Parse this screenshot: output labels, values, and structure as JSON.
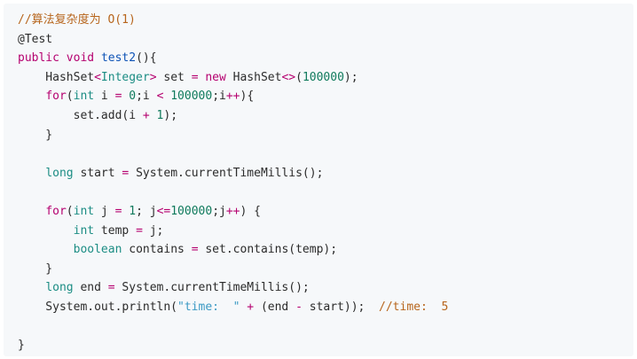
{
  "colors": {
    "background": "#f6f8fa",
    "comment": "#b7651c",
    "keyword": "#b5006f",
    "function": "#0e53b6",
    "type": "#1c8d84",
    "number": "#0f7a5c",
    "string": "#3c9ac4",
    "plain": "#2b2b2b"
  },
  "code": {
    "lines": [
      [
        {
          "t": "//算法复杂度为 O(1)",
          "k": "comment"
        }
      ],
      [
        {
          "t": "@Test",
          "k": "plain"
        }
      ],
      [
        {
          "t": "public",
          "k": "keyword"
        },
        {
          "t": " ",
          "k": "plain"
        },
        {
          "t": "void",
          "k": "keyword"
        },
        {
          "t": " ",
          "k": "plain"
        },
        {
          "t": "test2",
          "k": "function"
        },
        {
          "t": "(){",
          "k": "plain"
        }
      ],
      [
        {
          "t": "    HashSet",
          "k": "plain"
        },
        {
          "t": "<",
          "k": "operator"
        },
        {
          "t": "Integer",
          "k": "type"
        },
        {
          "t": ">",
          "k": "operator"
        },
        {
          "t": " set ",
          "k": "plain"
        },
        {
          "t": "=",
          "k": "operator"
        },
        {
          "t": " ",
          "k": "plain"
        },
        {
          "t": "new",
          "k": "keyword"
        },
        {
          "t": " HashSet",
          "k": "plain"
        },
        {
          "t": "<>",
          "k": "operator"
        },
        {
          "t": "(",
          "k": "plain"
        },
        {
          "t": "100000",
          "k": "number"
        },
        {
          "t": ");",
          "k": "plain"
        }
      ],
      [
        {
          "t": "    ",
          "k": "plain"
        },
        {
          "t": "for",
          "k": "keyword"
        },
        {
          "t": "(",
          "k": "plain"
        },
        {
          "t": "int",
          "k": "type"
        },
        {
          "t": " i ",
          "k": "plain"
        },
        {
          "t": "=",
          "k": "operator"
        },
        {
          "t": " ",
          "k": "plain"
        },
        {
          "t": "0",
          "k": "number"
        },
        {
          "t": ";i ",
          "k": "plain"
        },
        {
          "t": "<",
          "k": "operator"
        },
        {
          "t": " ",
          "k": "plain"
        },
        {
          "t": "100000",
          "k": "number"
        },
        {
          "t": ";i",
          "k": "plain"
        },
        {
          "t": "++",
          "k": "operator"
        },
        {
          "t": "){",
          "k": "plain"
        }
      ],
      [
        {
          "t": "        set.add(i ",
          "k": "plain"
        },
        {
          "t": "+",
          "k": "operator"
        },
        {
          "t": " ",
          "k": "plain"
        },
        {
          "t": "1",
          "k": "number"
        },
        {
          "t": ");",
          "k": "plain"
        }
      ],
      [
        {
          "t": "    }",
          "k": "plain"
        }
      ],
      [],
      [
        {
          "t": "    ",
          "k": "plain"
        },
        {
          "t": "long",
          "k": "type"
        },
        {
          "t": " start ",
          "k": "plain"
        },
        {
          "t": "=",
          "k": "operator"
        },
        {
          "t": " System.currentTimeMillis();",
          "k": "plain"
        }
      ],
      [],
      [
        {
          "t": "    ",
          "k": "plain"
        },
        {
          "t": "for",
          "k": "keyword"
        },
        {
          "t": "(",
          "k": "plain"
        },
        {
          "t": "int",
          "k": "type"
        },
        {
          "t": " j ",
          "k": "plain"
        },
        {
          "t": "=",
          "k": "operator"
        },
        {
          "t": " ",
          "k": "plain"
        },
        {
          "t": "1",
          "k": "number"
        },
        {
          "t": "; j",
          "k": "plain"
        },
        {
          "t": "<=",
          "k": "operator"
        },
        {
          "t": "100000",
          "k": "number"
        },
        {
          "t": ";j",
          "k": "plain"
        },
        {
          "t": "++",
          "k": "operator"
        },
        {
          "t": ") {",
          "k": "plain"
        }
      ],
      [
        {
          "t": "        ",
          "k": "plain"
        },
        {
          "t": "int",
          "k": "type"
        },
        {
          "t": " temp ",
          "k": "plain"
        },
        {
          "t": "=",
          "k": "operator"
        },
        {
          "t": " j;",
          "k": "plain"
        }
      ],
      [
        {
          "t": "        ",
          "k": "plain"
        },
        {
          "t": "boolean",
          "k": "type"
        },
        {
          "t": " contains ",
          "k": "plain"
        },
        {
          "t": "=",
          "k": "operator"
        },
        {
          "t": " set.contains(temp);",
          "k": "plain"
        }
      ],
      [
        {
          "t": "    }",
          "k": "plain"
        }
      ],
      [
        {
          "t": "    ",
          "k": "plain"
        },
        {
          "t": "long",
          "k": "type"
        },
        {
          "t": " end ",
          "k": "plain"
        },
        {
          "t": "=",
          "k": "operator"
        },
        {
          "t": " System.currentTimeMillis();",
          "k": "plain"
        }
      ],
      [
        {
          "t": "    System.out.println(",
          "k": "plain"
        },
        {
          "t": "\"time:  \"",
          "k": "string"
        },
        {
          "t": " ",
          "k": "plain"
        },
        {
          "t": "+",
          "k": "operator"
        },
        {
          "t": " (end ",
          "k": "plain"
        },
        {
          "t": "-",
          "k": "operator"
        },
        {
          "t": " start));  ",
          "k": "plain"
        },
        {
          "t": "//time:  5",
          "k": "comment"
        }
      ],
      [],
      [
        {
          "t": "}",
          "k": "plain"
        }
      ]
    ]
  }
}
